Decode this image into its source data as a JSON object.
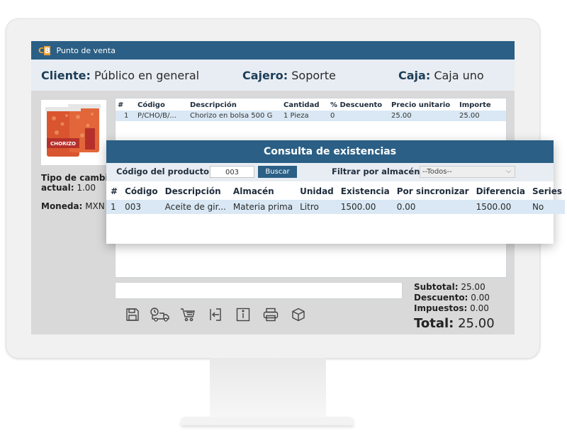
{
  "app": {
    "logo_c": "C",
    "logo_b": "B",
    "title": "Punto de venta"
  },
  "info": {
    "client_label": "Cliente:",
    "client_value": "Público en general",
    "cashier_label": "Cajero:",
    "cashier_value": "Soporte",
    "register_label": "Caja:",
    "register_value": "Caja uno"
  },
  "left": {
    "product_image_label": "CHORIZO",
    "exchange_label_1": "Tipo de cambio",
    "exchange_label_2": "actual:",
    "exchange_value": "1.00",
    "currency_label": "Moneda:",
    "currency_value": "MXN"
  },
  "sale_grid": {
    "headers": [
      "#",
      "Código",
      "Descripción",
      "Cantidad",
      "% Descuento",
      "Precio unitario",
      "Importe"
    ],
    "rows": [
      [
        "1",
        "P/CHO/B/...",
        "Chorizo en bolsa 500 G",
        "1 Pieza",
        "0",
        "25.00",
        "25.00"
      ]
    ]
  },
  "totals": {
    "subtotal_label": "Subtotal:",
    "subtotal_value": "25.00",
    "discount_label": "Descuento:",
    "discount_value": "0.00",
    "taxes_label": "Impuestos:",
    "taxes_value": "0.00",
    "total_label": "Total:",
    "total_value": "25.00"
  },
  "toolbar": {
    "icons": [
      "save-icon",
      "delivery-truck-icon",
      "shopping-cart-icon",
      "exit-icon",
      "info-icon",
      "printer-icon",
      "package-icon"
    ]
  },
  "modal": {
    "title": "Consulta de existencias",
    "code_label": "Código del producto:",
    "code_value": "003",
    "search_button": "Buscar",
    "warehouse_label": "Filtrar por almacén:",
    "warehouse_selected": "--Todos--",
    "headers": [
      "#",
      "Código",
      "Descripción",
      "Almacén",
      "Unidad",
      "Existencia",
      "Por sincronizar",
      "Diferencia",
      "Series"
    ],
    "rows": [
      [
        "1",
        "003",
        "Aceite de gir...",
        "Materia prima",
        "Litro",
        "1500.00",
        "0.00",
        "1500.00",
        "No"
      ]
    ]
  },
  "colors": {
    "header_blue": "#2b5f85",
    "band": "#e8edf3",
    "row_highlight": "#d9e8f4",
    "logo_orange": "#f2a33a"
  }
}
